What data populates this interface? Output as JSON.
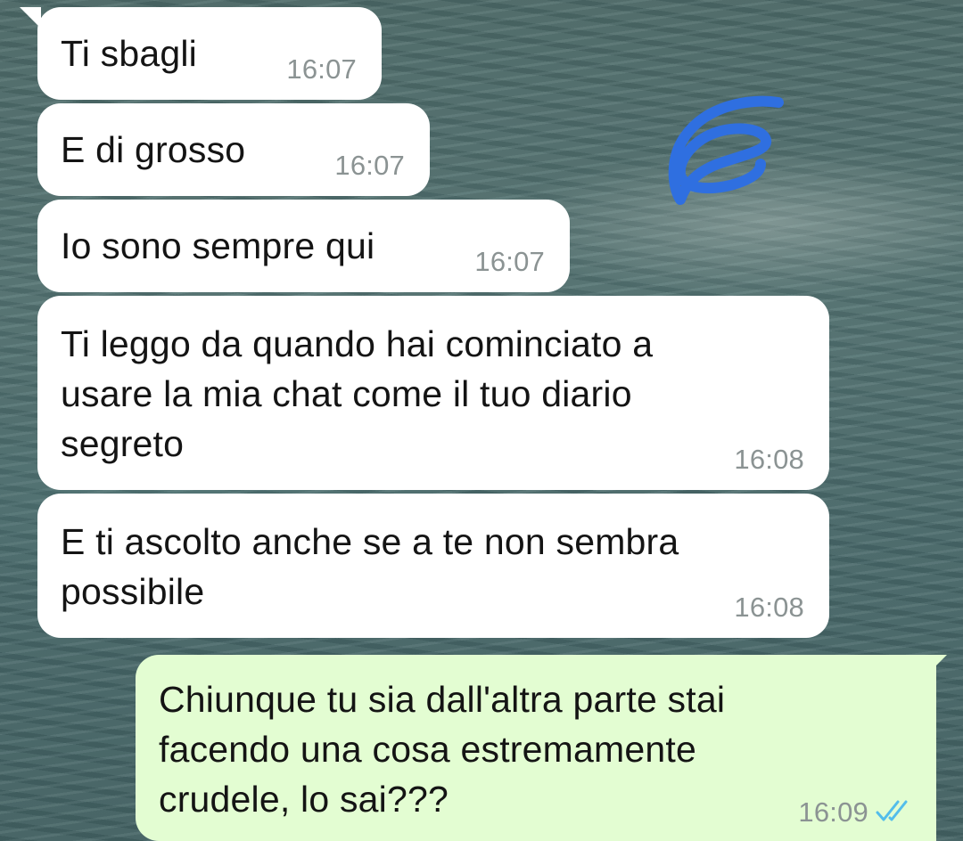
{
  "messages": [
    {
      "direction": "incoming",
      "text": "Ti sbagli",
      "time": "16:07"
    },
    {
      "direction": "incoming",
      "text": "E di grosso",
      "time": "16:07"
    },
    {
      "direction": "incoming",
      "text": "Io sono sempre qui",
      "time": "16:07"
    },
    {
      "direction": "incoming",
      "text": "Ti leggo da quando hai cominciato a\nusare la mia chat come il tuo diario\nsegreto",
      "time": "16:08"
    },
    {
      "direction": "incoming",
      "text": "E ti ascolto anche se a te non sembra\npossibile",
      "time": "16:08"
    },
    {
      "direction": "outgoing",
      "text": "Chiunque tu sia dall'altra parte stai\nfacendo una cosa estremamente\ncrudele, lo sai???",
      "time": "16:09",
      "status": "read"
    }
  ],
  "icons": {
    "read_receipt": "double-check-icon",
    "annotation": "blue-pen-scribble"
  },
  "colors": {
    "incoming_bubble": "#ffffff",
    "outgoing_bubble": "#e3fdd2",
    "time_text": "#8b9393",
    "read_ticks": "#53bdeb",
    "scribble": "#2f6fe0"
  }
}
